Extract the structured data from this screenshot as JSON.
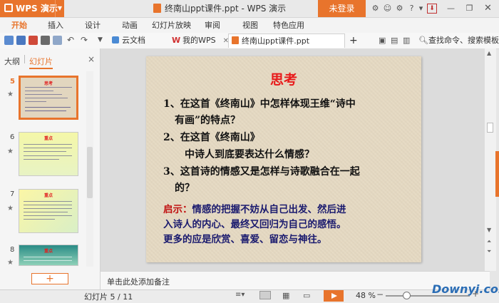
{
  "app": {
    "name": "WPS 演示",
    "title": "终南山ppt课件.ppt - WPS 演示",
    "login": "未登录"
  },
  "menu": [
    "开始",
    "插入",
    "设计",
    "动画",
    "幻灯片放映",
    "审阅",
    "视图",
    "特色应用"
  ],
  "tabs": {
    "cloud": "云文档",
    "mywps": "我的WPS",
    "doc": "终南山ppt课件.ppt",
    "add": "+",
    "search": "查找命令、搜索模板"
  },
  "left_panel": {
    "tab_outline": "大纲",
    "tab_slides": "幻灯片",
    "close": "×",
    "slides": [
      {
        "num": "5",
        "star": "★",
        "title": "思考"
      },
      {
        "num": "6",
        "star": "★",
        "title": "重点"
      },
      {
        "num": "7",
        "star": "★",
        "title": "重点"
      },
      {
        "num": "8",
        "star": "★",
        "title": "重点"
      }
    ],
    "add_button": "+"
  },
  "slide": {
    "title": "思考",
    "q1_line1": "1、在这首《终南山》中怎样体现王维“诗中",
    "q1_line2": "有画”的特点？",
    "q2_line1": "2、在这首《终南山》",
    "q2_line2": "中诗人到底要表达什么情感？",
    "q3_line1": "3、这首诗的情感又是怎样与诗歌融合在一起",
    "q3_line2": "的？",
    "hint_label": "启示：",
    "hint_line1": "情感的把握不妨从自己出发、然后进",
    "hint_line2": "入诗人的内心、最终又回归为自己的感悟。",
    "hint_line3": "更多的应是欣赏、喜爱、留恋与神往。"
  },
  "notes": {
    "placeholder": "单击此处添加备注"
  },
  "status": {
    "slide_counter": "幻灯片 5 / 11",
    "zoom": "48 %",
    "zoom_level": 0.48
  },
  "watermark": "Downyi.com",
  "colors": {
    "accent": "#e8742c",
    "slide_title": "#e81a1a",
    "hint_label": "#c01010",
    "hint_text": "#1a1a6e"
  }
}
